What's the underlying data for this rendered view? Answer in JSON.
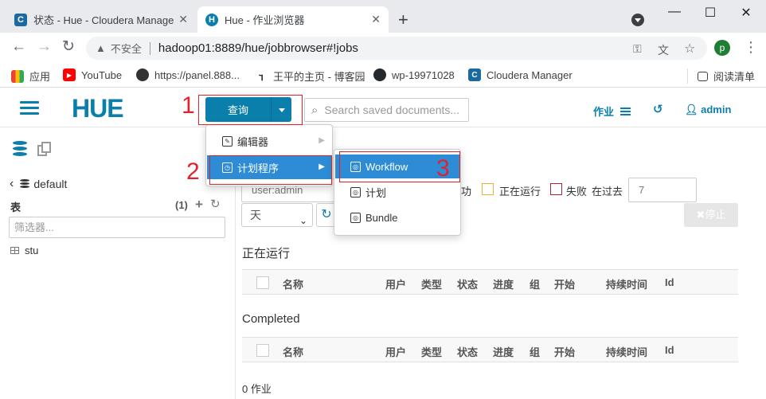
{
  "browser": {
    "tabs": [
      {
        "title": "状态 - Hue - Cloudera Manage",
        "icon": "cloudera-icon"
      },
      {
        "title": "Hue - 作业浏览器",
        "icon": "hue-icon"
      }
    ],
    "address": {
      "insecure_label": "不安全",
      "url": "hadoop01:8889/hue/jobbrowser#!jobs"
    },
    "profile_initial": "p",
    "bookmarks": [
      {
        "label": "应用",
        "icon": "apps-grid-icon"
      },
      {
        "label": "YouTube",
        "icon": "youtube-icon"
      },
      {
        "label": "https://panel.888...",
        "icon": "globe-icon"
      },
      {
        "label": "王平的主页 - 博客园",
        "icon": "cnblogs-icon"
      },
      {
        "label": "wp-19971028",
        "icon": "github-icon"
      },
      {
        "label": "Cloudera Manager",
        "icon": "cloudera-icon"
      }
    ],
    "reading_list": "阅读清单"
  },
  "hue": {
    "logo": "HUE",
    "query_button": "查询",
    "search_placeholder": "Search saved documents...",
    "jobs_label": "作业",
    "user_label": "admin",
    "sidebar": {
      "database": "default",
      "tables_header": "表",
      "table_count": "(1)",
      "filter_placeholder": "筛选器...",
      "tables": [
        "stu"
      ]
    },
    "filters": {
      "user_filter": "user:admin",
      "success_tail": "功",
      "running": "正在运行",
      "failed": "失败",
      "past_label": "在过去",
      "past_value": "7",
      "unit": "天",
      "stop": "停止"
    },
    "sections": {
      "running_title": "正在运行",
      "completed_title": "Completed"
    },
    "columns": [
      "名称",
      "用户",
      "类型",
      "状态",
      "进度",
      "组",
      "开始",
      "持续时间",
      "Id"
    ],
    "job_count": "0 作业",
    "menu": {
      "items": [
        {
          "label": "编辑器",
          "icon": "editor-icon"
        },
        {
          "label": "计划程序",
          "icon": "scheduler-icon"
        }
      ],
      "submenu": [
        "Workflow",
        "计划",
        "Bundle"
      ]
    },
    "annotations": [
      "1",
      "2",
      "3"
    ],
    "colors": {
      "accent": "#0b7fab",
      "menu_highlight": "#2d8cd5",
      "annotation": "#e0232a",
      "running": "#e8b33b",
      "failed": "#a8253c"
    }
  }
}
